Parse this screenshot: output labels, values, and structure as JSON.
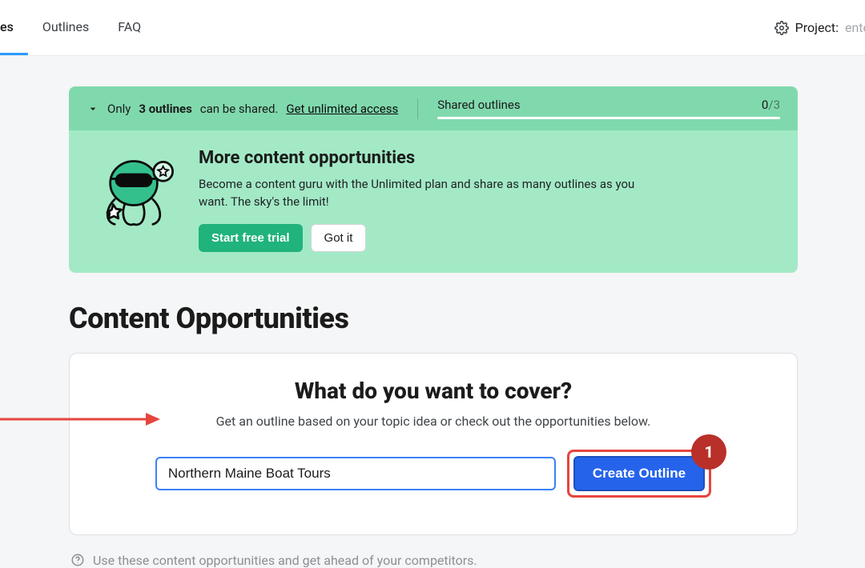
{
  "tabs": {
    "partial": "es",
    "outlines": "Outlines",
    "faq": "FAQ"
  },
  "project": {
    "label": "Project",
    "value": "ente"
  },
  "banner_strip": {
    "prefix": "Only ",
    "bold": "3 outlines",
    "suffix": " can be shared. ",
    "link": "Get unlimited access",
    "shared_label": "Shared outlines",
    "shared_current": "0",
    "shared_sep": "/",
    "shared_total": "3"
  },
  "banner_body": {
    "title": "More content opportunities",
    "text": "Become a content guru with the Unlimited plan and share as many outlines as you want. The sky's the limit!",
    "cta_primary": "Start free trial",
    "cta_secondary": "Got it"
  },
  "page_title": "Content Opportunities",
  "card": {
    "title": "What do you want to cover?",
    "subtitle": "Get an outline based on your topic idea or check out the opportunities below.",
    "input_value": "Northern Maine Boat Tours",
    "create_label": "Create Outline",
    "badge": "1"
  },
  "hint": "Use these content opportunities and get ahead of your competitors."
}
